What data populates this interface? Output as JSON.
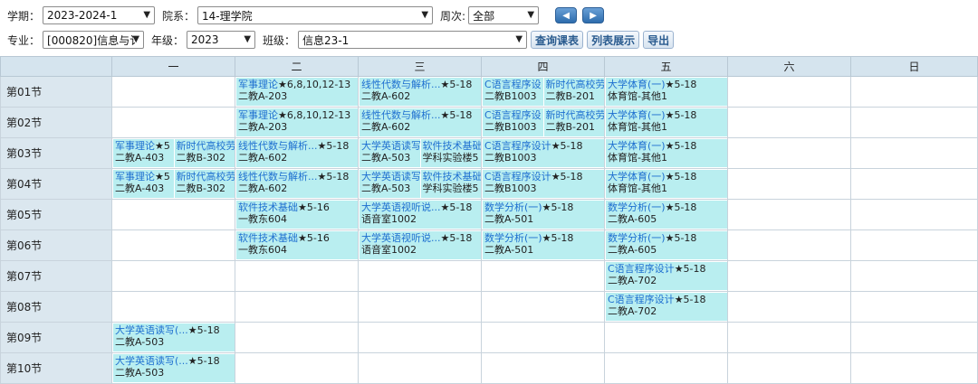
{
  "filters": {
    "term_label": "学期：",
    "term_value": "2023-2024-1",
    "dept_label": "院系：",
    "dept_value": "14-理学院",
    "week_label": "周次:",
    "week_value": "全部",
    "major_label": "专业：",
    "major_value": "[000820]信息与讠",
    "grade_label": "年级：",
    "grade_value": "2023",
    "class_label": "班级：",
    "class_value": "信息23-1",
    "query_btn": "查询课表",
    "list_btn": "列表展示",
    "export_btn": "导出"
  },
  "days": [
    "一",
    "二",
    "三",
    "四",
    "五",
    "六",
    "日"
  ],
  "periods": [
    "第01节",
    "第02节",
    "第03节",
    "第04节",
    "第05节",
    "第06节",
    "第07节",
    "第08节",
    "第09节",
    "第10节"
  ],
  "schedule": {
    "p1": {
      "d2": [
        {
          "course": "军事理论",
          "weeks": "★6,8,10,12-13",
          "room": "二教A-203"
        }
      ],
      "d3": [
        {
          "course": "线性代数与解析...",
          "weeks": "★5-18",
          "room": "二教A-602"
        }
      ],
      "d4": [
        {
          "course": "C语言程序设",
          "weeks": "",
          "room": "二教B1003"
        },
        {
          "course": "新时代高校劳",
          "weeks": "",
          "room": "二教B-201"
        }
      ],
      "d5": [
        {
          "course": "大学体育(一)",
          "weeks": "★5-18",
          "room": "体育馆-其他1"
        }
      ]
    },
    "p2": {
      "d2": [
        {
          "course": "军事理论",
          "weeks": "★6,8,10,12-13",
          "room": "二教A-203"
        }
      ],
      "d3": [
        {
          "course": "线性代数与解析...",
          "weeks": "★5-18",
          "room": "二教A-602"
        }
      ],
      "d4": [
        {
          "course": "C语言程序设",
          "weeks": "",
          "room": "二教B1003"
        },
        {
          "course": "新时代高校劳",
          "weeks": "",
          "room": "二教B-201"
        }
      ],
      "d5": [
        {
          "course": "大学体育(一)",
          "weeks": "★5-18",
          "room": "体育馆-其他1"
        }
      ]
    },
    "p3": {
      "d1": [
        {
          "course": "军事理论",
          "weeks": "★5",
          "room": "二教A-403"
        },
        {
          "course": "新时代高校劳",
          "weeks": "",
          "room": "二教B-302"
        }
      ],
      "d2": [
        {
          "course": "线性代数与解析...",
          "weeks": "★5-18",
          "room": "二教A-602"
        }
      ],
      "d3": [
        {
          "course": "大学英语读写",
          "weeks": "",
          "room": "二教A-503"
        },
        {
          "course": "软件技术基础",
          "weeks": "",
          "room": "学科实验楼5"
        }
      ],
      "d4": [
        {
          "course": "C语言程序设计",
          "weeks": "★5-18",
          "room": "二教B1003"
        }
      ],
      "d5": [
        {
          "course": "大学体育(一)",
          "weeks": "★5-18",
          "room": "体育馆-其他1"
        }
      ]
    },
    "p4": {
      "d1": [
        {
          "course": "军事理论",
          "weeks": "★5",
          "room": "二教A-403"
        },
        {
          "course": "新时代高校劳",
          "weeks": "",
          "room": "二教B-302"
        }
      ],
      "d2": [
        {
          "course": "线性代数与解析...",
          "weeks": "★5-18",
          "room": "二教A-602"
        }
      ],
      "d3": [
        {
          "course": "大学英语读写",
          "weeks": "",
          "room": "二教A-503"
        },
        {
          "course": "软件技术基础",
          "weeks": "",
          "room": "学科实验楼5"
        }
      ],
      "d4": [
        {
          "course": "C语言程序设计",
          "weeks": "★5-18",
          "room": "二教B1003"
        }
      ],
      "d5": [
        {
          "course": "大学体育(一)",
          "weeks": "★5-18",
          "room": "体育馆-其他1"
        }
      ]
    },
    "p5": {
      "d2": [
        {
          "course": "软件技术基础",
          "weeks": "★5-16",
          "room": "一教东604"
        }
      ],
      "d3": [
        {
          "course": "大学英语视听说...",
          "weeks": "★5-18",
          "room": "语音室1002"
        }
      ],
      "d4": [
        {
          "course": "数学分析(一)",
          "weeks": "★5-18",
          "room": "二教A-501"
        }
      ],
      "d5": [
        {
          "course": "数学分析(一)",
          "weeks": "★5-18",
          "room": "二教A-605"
        }
      ]
    },
    "p6": {
      "d2": [
        {
          "course": "软件技术基础",
          "weeks": "★5-16",
          "room": "一教东604"
        }
      ],
      "d3": [
        {
          "course": "大学英语视听说...",
          "weeks": "★5-18",
          "room": "语音室1002"
        }
      ],
      "d4": [
        {
          "course": "数学分析(一)",
          "weeks": "★5-18",
          "room": "二教A-501"
        }
      ],
      "d5": [
        {
          "course": "数学分析(一)",
          "weeks": "★5-18",
          "room": "二教A-605"
        }
      ]
    },
    "p7": {
      "d5": [
        {
          "course": "C语言程序设计",
          "weeks": "★5-18",
          "room": "二教A-702"
        }
      ]
    },
    "p8": {
      "d5": [
        {
          "course": "C语言程序设计",
          "weeks": "★5-18",
          "room": "二教A-702"
        }
      ]
    },
    "p9": {
      "d1": [
        {
          "course": "大学英语读写(...",
          "weeks": "★5-18",
          "room": "二教A-503"
        }
      ]
    },
    "p10": {
      "d1": [
        {
          "course": "大学英语读写(...",
          "weeks": "★5-18",
          "room": "二教A-503"
        }
      ]
    }
  }
}
